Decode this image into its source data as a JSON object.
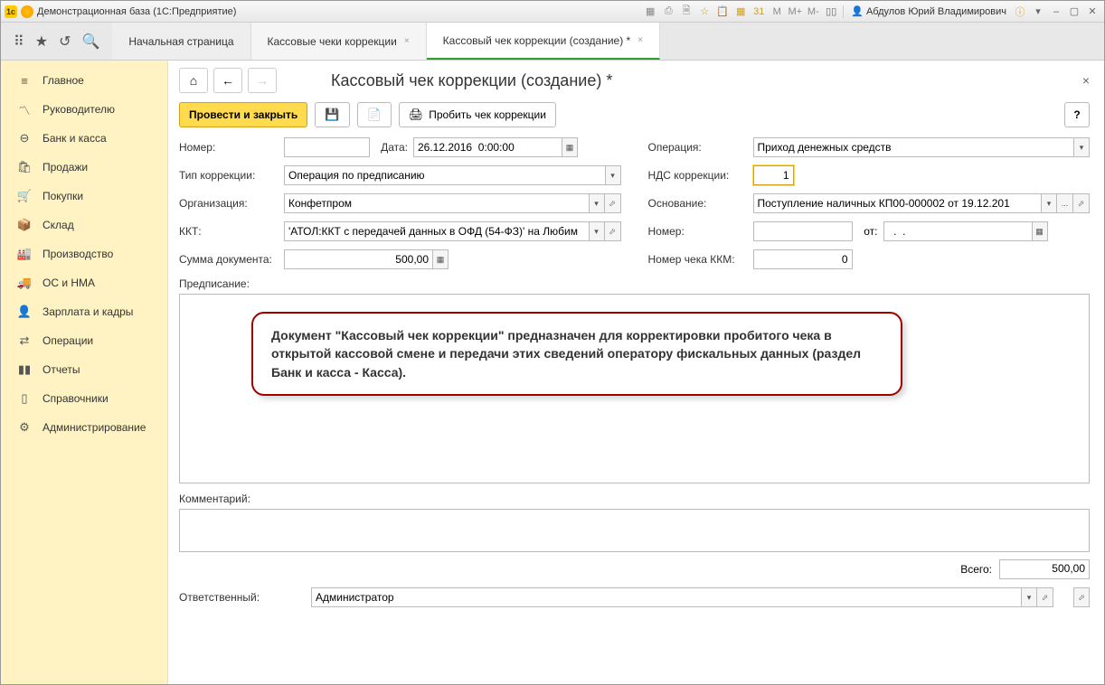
{
  "titlebar": {
    "title": "Демонстрационная база  (1С:Предприятие)",
    "user": "Абдулов Юрий Владимирович"
  },
  "tabs": {
    "start": "Начальная страница",
    "t1": "Кассовые чеки коррекции",
    "t2": "Кассовый чек коррекции (создание) *"
  },
  "sidebar": {
    "items": [
      "Главное",
      "Руководителю",
      "Банк и касса",
      "Продажи",
      "Покупки",
      "Склад",
      "Производство",
      "ОС и НМА",
      "Зарплата и кадры",
      "Операции",
      "Отчеты",
      "Справочники",
      "Администрирование"
    ]
  },
  "page": {
    "title": "Кассовый чек коррекции (создание) *"
  },
  "toolbar": {
    "post_close": "Провести и закрыть",
    "punch": "Пробить чек коррекции",
    "help": "?"
  },
  "form": {
    "number_label": "Номер:",
    "number": "",
    "date_label": "Дата:",
    "date": "26.12.2016  0:00:00",
    "corr_type_label": "Тип коррекции:",
    "corr_type": "Операция по предписанию",
    "org_label": "Организация:",
    "org": "Конфетпром",
    "kkt_label": "ККТ:",
    "kkt": "'АТОЛ:ККТ с передачей данных в ОФД (54-ФЗ)' на Любим",
    "sum_label": "Сумма документа:",
    "sum": "500,00",
    "op_label": "Операция:",
    "op": "Приход денежных средств",
    "vat_label": "НДС коррекции:",
    "vat": "1",
    "basis_label": "Основание:",
    "basis": "Поступление наличных КП00-000002 от 19.12.201",
    "basis_more": "...",
    "num2_label": "Номер:",
    "num2": "",
    "ot": "от:",
    "ot_date": "  .  .    ",
    "kkm_label": "Номер чека ККМ:",
    "kkm": "0",
    "prescr_label": "Предписание:",
    "comment_label": "Комментарий:",
    "total_label": "Всего:",
    "total": "500,00",
    "resp_label": "Ответственный:",
    "resp": "Администратор"
  },
  "callout": "Документ \"Кассовый чек коррекции\" предназначен для корректировки пробитого чека в открытой кассовой смене и передачи этих сведений оператору фискальных данных  (раздел Банк и касса - Касса)."
}
